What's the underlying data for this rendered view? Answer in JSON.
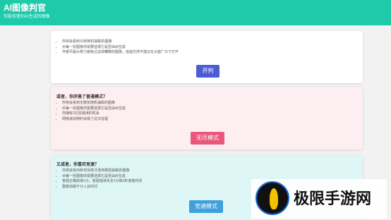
{
  "header": {
    "title": "AI图像判官",
    "subtitle": "你能否鉴别AI生成的图像"
  },
  "card_normal": {
    "items": [
      "你将会看到10张随机抽取的图像",
      "对每一张图像你需要选择它是否由AI生成",
      "作者尽最大努力避免过滤掉糟糕的图像，但是仍然不建议在大庭广众下打开"
    ],
    "button_label": "开判"
  },
  "card_endless": {
    "heading": "或者，你厌倦了普通模式？",
    "items": [
      "你将会看到无数张随机抽取的图像",
      "对每一张图像你需要选择它是否由AI生成",
      "你拥有3次犯错误的机会",
      "网络波动随时会毁了这次征程"
    ],
    "button_label": "无尽模式"
  },
  "card_speed": {
    "heading": "又或者，你喜欢竞速？",
    "items": [
      "你将会有60秒时间依次看到随机抽取的图像",
      "对每一张图像你需要选择它是否由AI生成",
      "答题正确获得1分，答题错误失去1分和2秒答题时间",
      "图像加载不计入总时间"
    ],
    "button_label": "竞速模式"
  },
  "watermark": {
    "text": "极限手游网",
    "logo": "leaf-logo-icon"
  },
  "colors": {
    "header": "#1ecaaa",
    "button_start": "#4a5dd6",
    "button_endless": "#e9577a",
    "button_speed": "#3ea0dc"
  }
}
